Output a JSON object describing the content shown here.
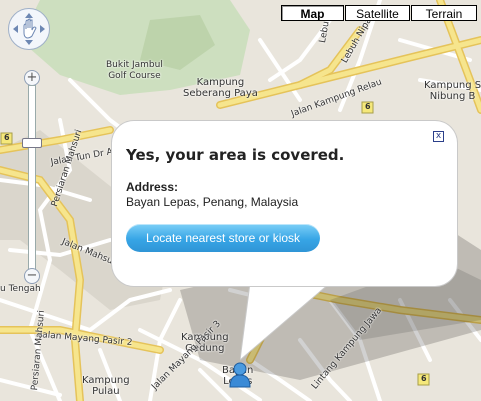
{
  "map_type": {
    "buttons": [
      {
        "label": "Map",
        "active": true
      },
      {
        "label": "Satellite",
        "active": false
      },
      {
        "label": "Terrain",
        "active": false
      }
    ]
  },
  "navigation": {
    "zoom_in": "+",
    "zoom_out": "−"
  },
  "map_labels": {
    "bukit_jambul": "Bukit Jambul\nGolf Course",
    "kampung_seberang_paya": "Kampung\nSeberang Paya",
    "jalan_kampung_relau": "Jalan Kampung Relau",
    "kampung_sungai_nibong": "Kampung S\nNibung B",
    "lebuh_nipah": "Lebuh Nipah",
    "lebuh_top": "Lebuh",
    "jalan_tun_dr": "Jalan Tun Dr A",
    "persiaran_mahsuri_1": "Persiaran Mahsuri",
    "jalan_mahsuri": "Jalan Mahsuri",
    "jalan_mayang_pasir_2": "Jalan Mayang Pasir 2",
    "persiaran_mahsuri_2": "Persiaran Mahsuri",
    "kampung_gedung": "Kampung\nGedung",
    "bayan_lepas": "Bayan\nLepas",
    "kampung_pulau": "Kampung\nPulau",
    "jalan_mayang_pasir_3": "Jalan Mayang Pasir 3",
    "lintang_kampung_jawa": "Lintang Kampung Jawa",
    "bukit_tengah": "u Tengah",
    "route_6_a": "6",
    "route_6_b": "6",
    "route_6_c": "6",
    "route_6_d": "6"
  },
  "info_window": {
    "title": "Yes, your area is covered.",
    "address_label": "Address:",
    "address": "Bayan Lepas, Penang, Malaysia",
    "button": "Locate nearest store or kiosk",
    "close": "x"
  },
  "colors": {
    "map_background": "#e9e5dc",
    "park_green": "#cddfbf",
    "major_road": "#f6e58d",
    "minor_road": "#ffffff",
    "button_blue": "#37a5e6"
  }
}
